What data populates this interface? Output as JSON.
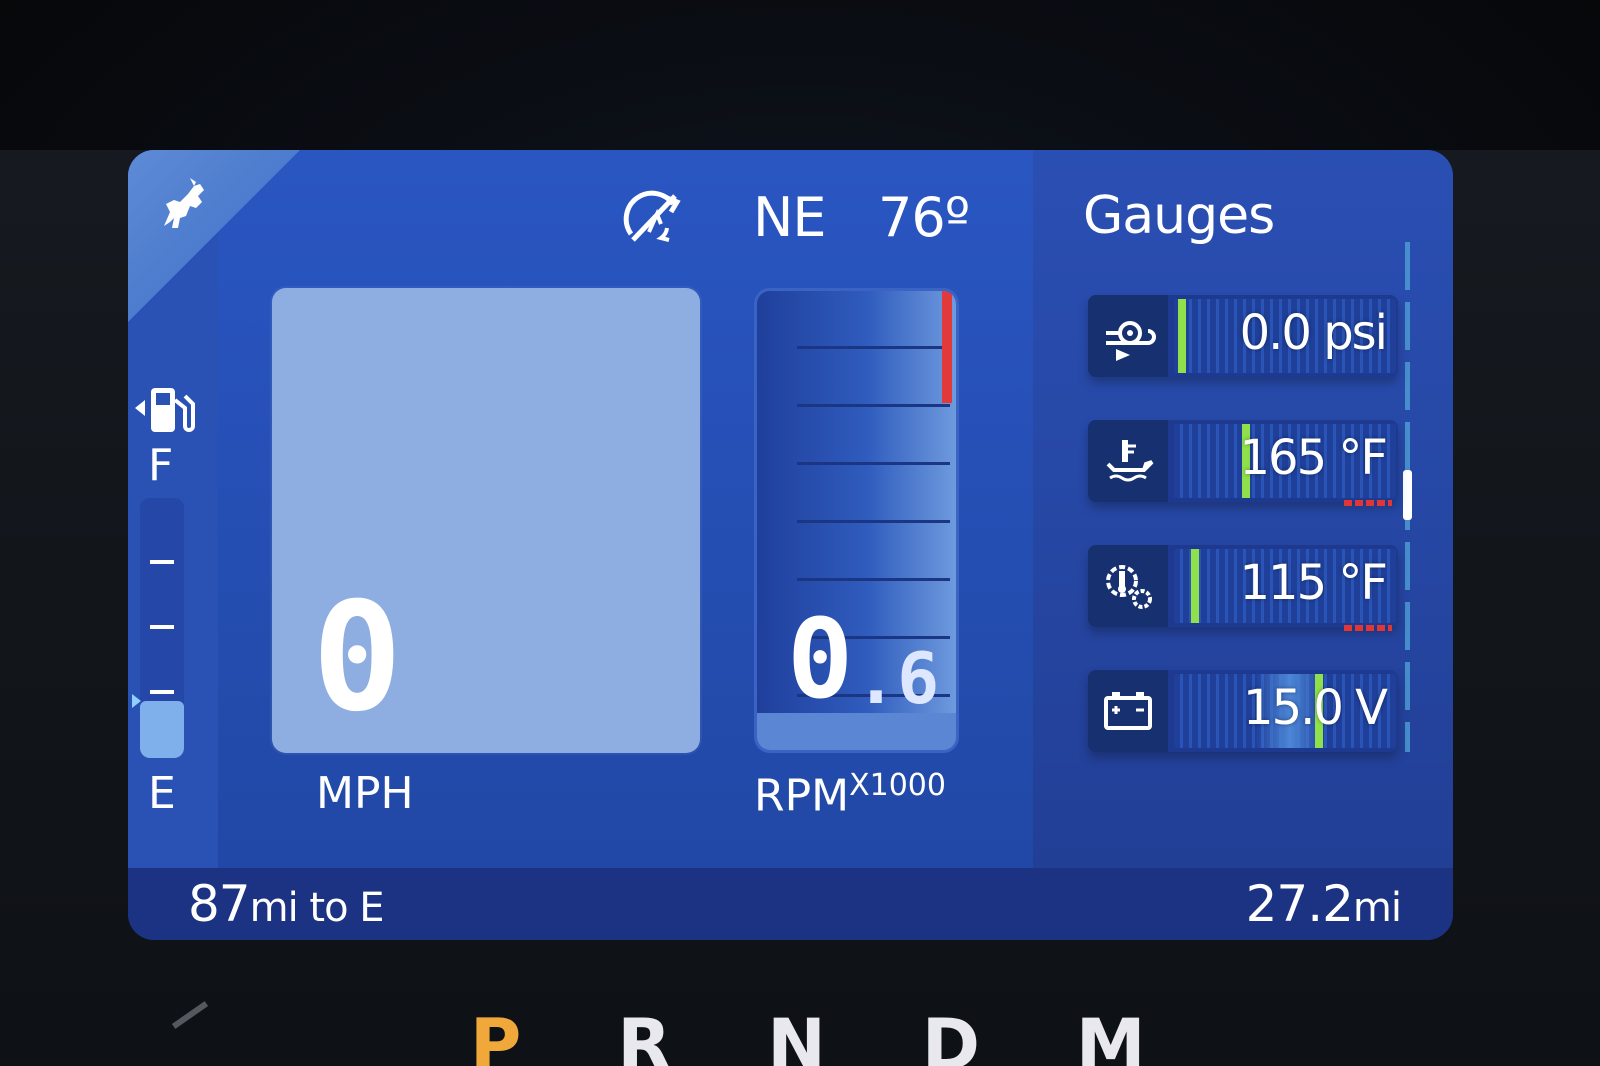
{
  "header": {
    "compass": "NE",
    "outside_temp": "76º"
  },
  "fuel": {
    "full_label": "F",
    "empty_label": "E",
    "level_fraction": 0.22
  },
  "speed": {
    "value": "0",
    "unit": "MPH"
  },
  "rpm": {
    "integer": "0",
    "decimal": ".6",
    "unit": "RPM",
    "multiplier": "X1000",
    "fraction_of_bar": 0.08
  },
  "gauges": {
    "title": "Gauges",
    "items": [
      {
        "name": "boost",
        "icon": "turbo-boost-icon",
        "value": "0.0 psi",
        "needle_fraction": 0.02,
        "redzone": false
      },
      {
        "name": "oil-temp",
        "icon": "oil-temperature-icon",
        "value": "165 °F",
        "needle_fraction": 0.32,
        "redzone": true
      },
      {
        "name": "trans-temp",
        "icon": "transmission-temperature-icon",
        "value": "115 °F",
        "needle_fraction": 0.08,
        "redzone": true
      },
      {
        "name": "battery",
        "icon": "battery-icon",
        "value": "15.0 V",
        "needle_fraction": 0.66,
        "redzone": false
      }
    ]
  },
  "footer": {
    "range_value": "87",
    "range_unit": "mi to E",
    "trip_value": "27.2",
    "trip_unit": "mi"
  },
  "gear_selector": {
    "gears": [
      "P",
      "R",
      "N",
      "D",
      "M"
    ],
    "active": "P"
  },
  "colors": {
    "accent_green": "#8fe04a",
    "redline": "#e23a3a",
    "gear_active": "#f0a83a"
  }
}
